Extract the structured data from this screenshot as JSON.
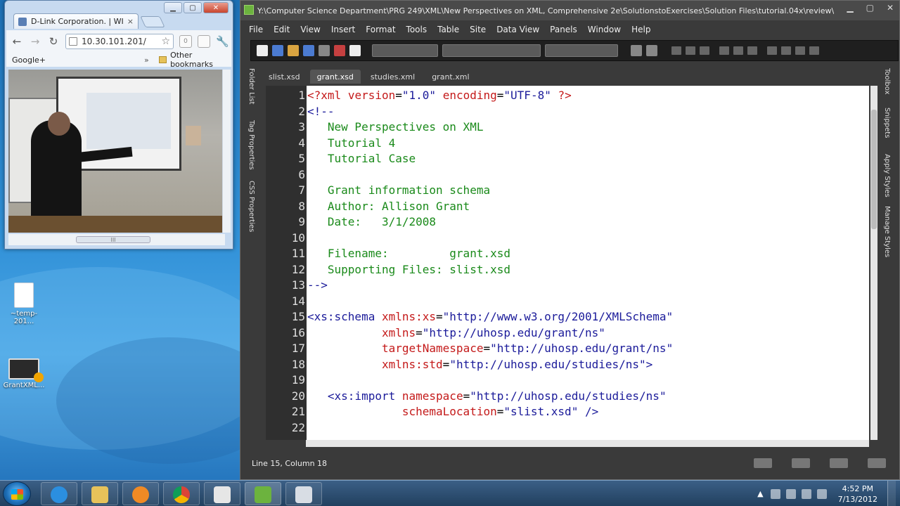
{
  "browser": {
    "tab_title": "D-Link Corporation. | WIR",
    "tab_close": "×",
    "address": "10.30.101.201/",
    "ext_badge": "0",
    "bookmarks_left": "Google+",
    "bookmarks_chevron": "»",
    "bookmarks_right": "Other bookmarks",
    "scroll_grip": "III"
  },
  "desktop": {
    "icons": [
      {
        "label": "~temp-201..."
      },
      {
        "label": "GrantXML..."
      }
    ]
  },
  "editor": {
    "title": "Y:\\Computer Science Department\\PRG 249\\XML\\New Perspectives on XML, Comprehensive 2e\\SolutionstoExercises\\Solution Files\\tutorial.04x\\review\\grant.xsd -...",
    "menu": [
      "File",
      "Edit",
      "View",
      "Insert",
      "Format",
      "Tools",
      "Table",
      "Site",
      "Data View",
      "Panels",
      "Window",
      "Help"
    ],
    "left_panels": [
      "Folder List",
      "Tag Properties",
      "CSS Properties"
    ],
    "right_panels": [
      "Toolbox",
      "Snippets",
      "Apply Styles",
      "Manage Styles"
    ],
    "doc_tabs": [
      "slist.xsd",
      "grant.xsd",
      "studies.xml",
      "grant.xml"
    ],
    "active_tab": "grant.xsd",
    "status": "Line 15, Column 18",
    "code_lines": [
      "1",
      "2",
      "3",
      "4",
      "5",
      "6",
      "7",
      "8",
      "9",
      "10",
      "11",
      "12",
      "13",
      "14",
      "15",
      "16",
      "17",
      "18",
      "19",
      "20",
      "21",
      "22"
    ]
  },
  "taskbar": {
    "time": "4:52 PM",
    "date": "7/13/2012"
  }
}
